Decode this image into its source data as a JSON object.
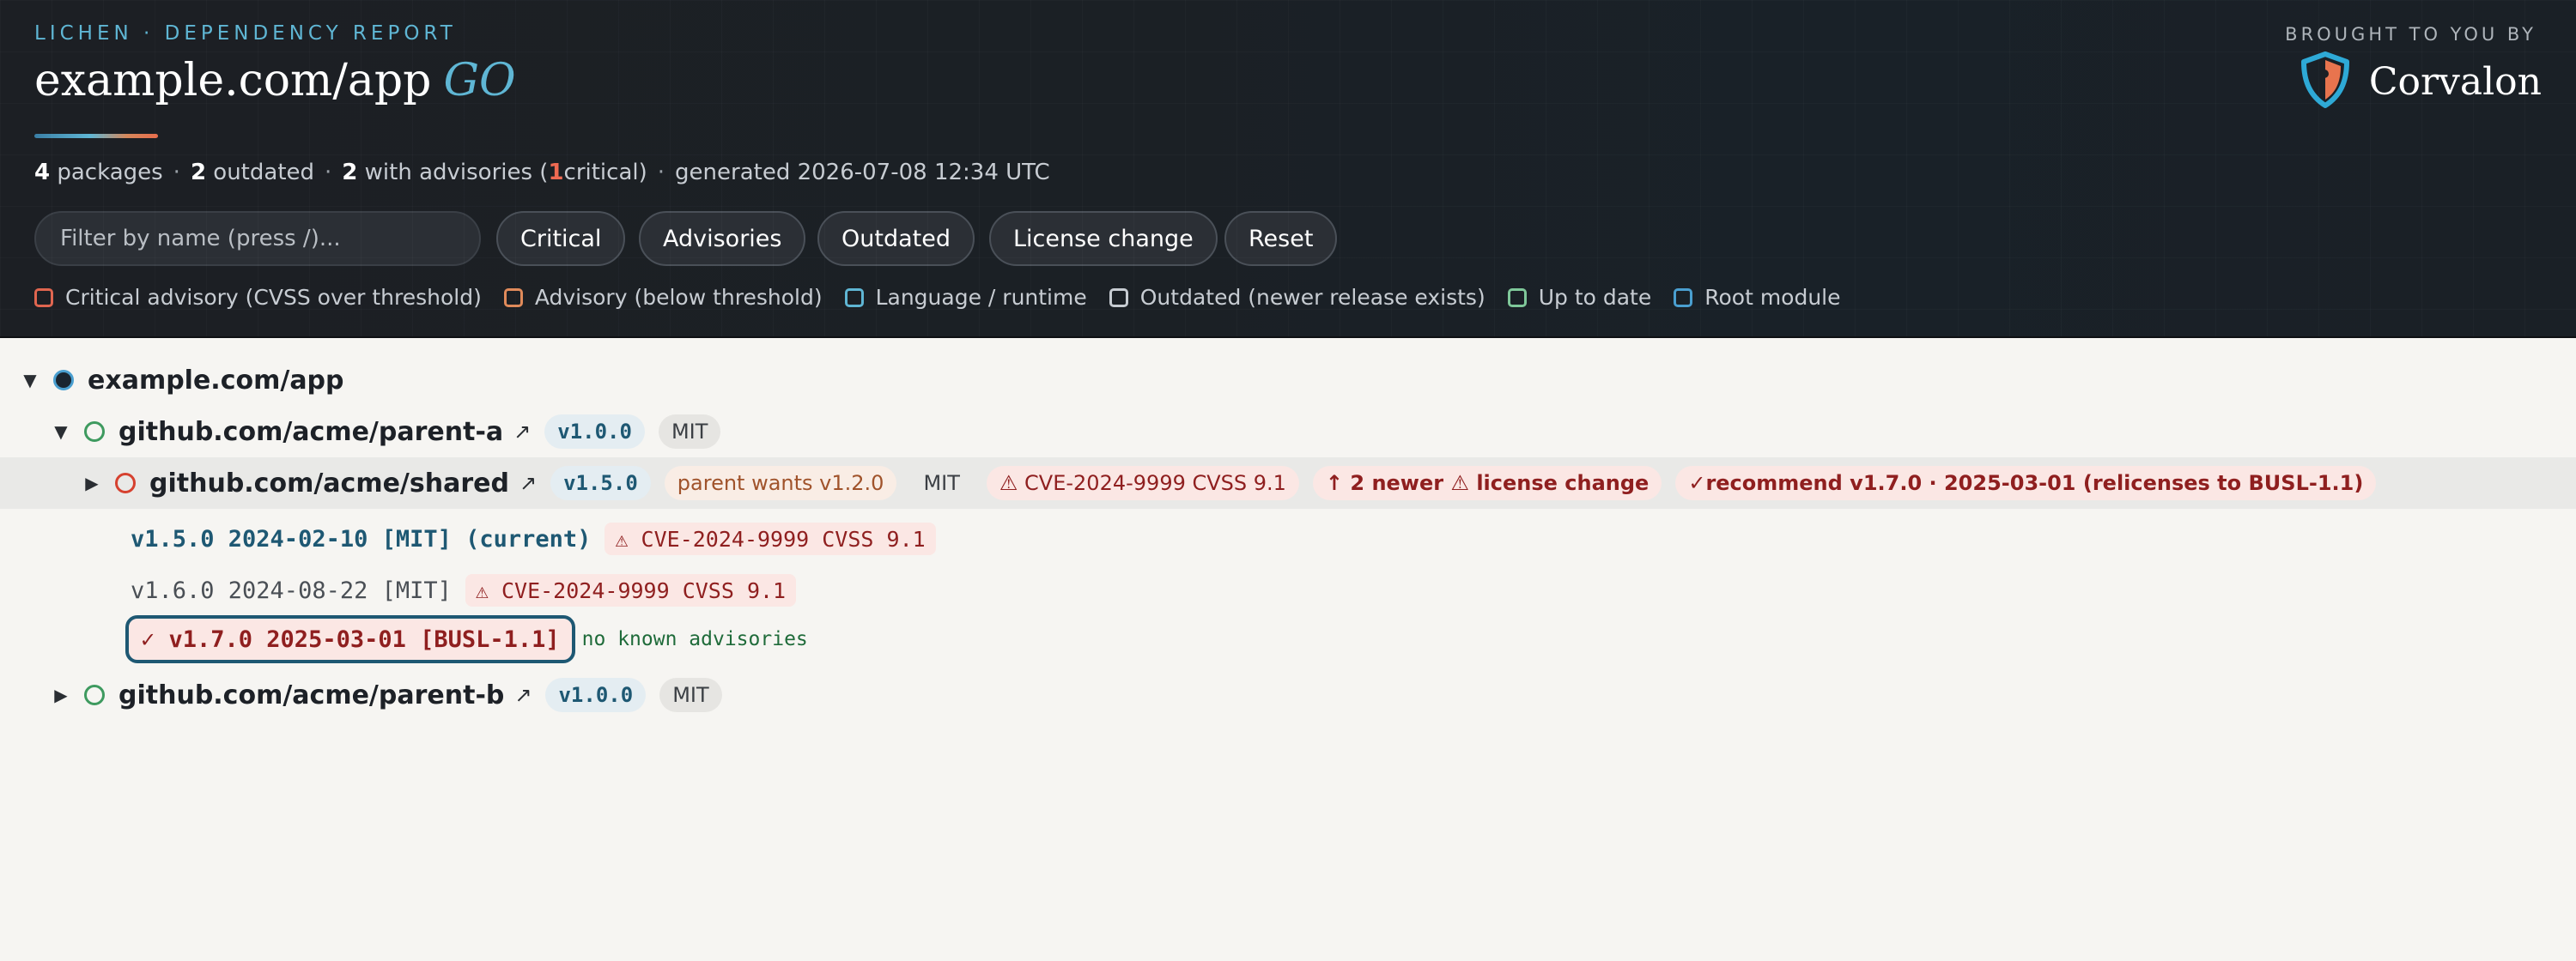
{
  "header": {
    "kicker": "LICHEN · DEPENDENCY REPORT",
    "title": "example.com/app",
    "language": "GO",
    "summary": {
      "packages_count": "4",
      "packages_label": "packages",
      "outdated_count": "2",
      "outdated_label": "outdated",
      "advisories_count": "2",
      "advisories_label": "with advisories (",
      "critical_count": "1",
      "critical_label": "critical)",
      "generated": "generated 2026-07-08 12:34 UTC"
    },
    "filter_placeholder": "Filter by name (press /)...",
    "buttons": {
      "critical": "Critical",
      "advisories": "Advisories",
      "outdated": "Outdated",
      "license_change": "License change",
      "reset": "Reset"
    },
    "legend": [
      {
        "label": "Critical advisory (CVSS over threshold)",
        "color": "#e0654f"
      },
      {
        "label": "Advisory (below threshold)",
        "color": "#e08a5a"
      },
      {
        "label": "Language / runtime",
        "color": "#5fb6d4"
      },
      {
        "label": "Outdated (newer release exists)",
        "color": "#c7ccd2"
      },
      {
        "label": "Up to date",
        "color": "#7fc89a"
      },
      {
        "label": "Root module",
        "color": "#4a9fd0"
      }
    ],
    "brand_kicker": "BROUGHT TO YOU BY",
    "brand_name": "Corvalon"
  },
  "tree": {
    "root": {
      "name": "example.com/app"
    },
    "parent_a": {
      "name": "github.com/acme/parent-a",
      "version": "v1.0.0",
      "license": "MIT"
    },
    "shared": {
      "name": "github.com/acme/shared",
      "version": "v1.5.0",
      "wants": "parent wants v1.2.0",
      "license": "MIT",
      "cve": "⚠ CVE-2024-9999 CVSS 9.1",
      "newer": "↑ 2 newer ⚠ license change",
      "recommend": "✓recommend v1.7.0 · 2025-03-01 (relicenses to BUSL-1.1)"
    },
    "versions": [
      {
        "text": "v1.5.0 2024-02-10 [MIT] (current)",
        "cve": "⚠ CVE-2024-9999 CVSS 9.1"
      },
      {
        "text": "v1.6.0 2024-08-22 [MIT]",
        "cve": "⚠ CVE-2024-9999 CVSS 9.1"
      },
      {
        "text": "✓ v1.7.0 2025-03-01 [BUSL-1.1]",
        "note": "no known advisories"
      }
    ],
    "parent_b": {
      "name": "github.com/acme/parent-b",
      "version": "v1.0.0",
      "license": "MIT"
    }
  },
  "colors": {
    "accent": "#5fb6d4",
    "critical": "#e0654f",
    "ok": "#3e9a5f",
    "root": "#1a2530"
  }
}
